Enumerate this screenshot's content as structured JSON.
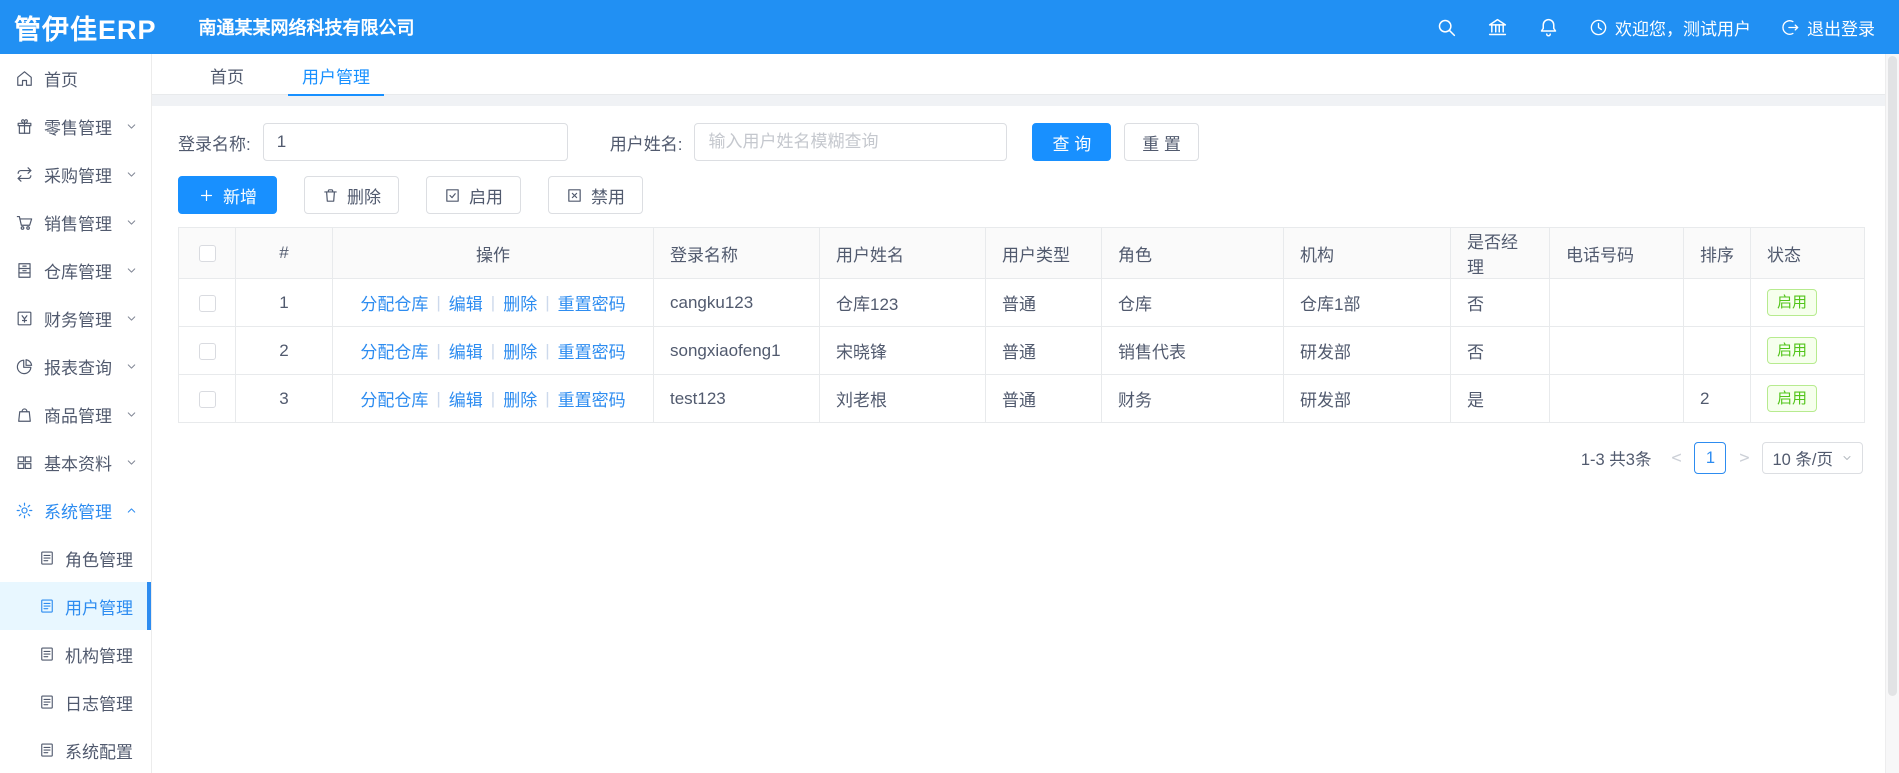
{
  "colors": {
    "header_bg": "#2190f3",
    "primary": "#1890ff",
    "link_blue": "#2d8cf0",
    "status_green": "#52c41a",
    "status_green_bg": "#f6ffed",
    "status_green_border": "#b7eb8f",
    "active_menu_bg": "#e8f7ff"
  },
  "header": {
    "logo": "管伊佳ERP",
    "company": "南通某某网络科技有限公司",
    "welcome": "欢迎您，测试用户",
    "logout": "退出登录"
  },
  "sidebar": {
    "items": [
      {
        "label": "首页",
        "icon": "home-icon"
      },
      {
        "label": "零售管理",
        "icon": "retail-icon"
      },
      {
        "label": "采购管理",
        "icon": "purchase-icon"
      },
      {
        "label": "销售管理",
        "icon": "sales-icon"
      },
      {
        "label": "仓库管理",
        "icon": "warehouse-icon"
      },
      {
        "label": "财务管理",
        "icon": "finance-icon"
      },
      {
        "label": "报表查询",
        "icon": "report-icon"
      },
      {
        "label": "商品管理",
        "icon": "goods-icon"
      },
      {
        "label": "基本资料",
        "icon": "basic-icon"
      },
      {
        "label": "系统管理",
        "icon": "system-icon"
      }
    ],
    "system_children": [
      {
        "label": "角色管理"
      },
      {
        "label": "用户管理",
        "active": true
      },
      {
        "label": "机构管理"
      },
      {
        "label": "日志管理"
      },
      {
        "label": "系统配置"
      }
    ]
  },
  "tabs": [
    {
      "label": "首页"
    },
    {
      "label": "用户管理",
      "active": true
    }
  ],
  "search": {
    "login_label": "登录名称:",
    "login_value": "1",
    "name_label": "用户姓名:",
    "name_placeholder": "输入用户姓名模糊查询",
    "query": "查 询",
    "reset": "重 置"
  },
  "toolbar": {
    "add": "新增",
    "delete": "删除",
    "enable": "启用",
    "disable": "禁用"
  },
  "table": {
    "columns": [
      "#",
      "操作",
      "登录名称",
      "用户姓名",
      "用户类型",
      "角色",
      "机构",
      "是否经理",
      "电话号码",
      "排序",
      "状态"
    ],
    "action_links": [
      "分配仓库",
      "编辑",
      "删除",
      "重置密码"
    ],
    "rows": [
      {
        "index": "1",
        "login": "cangku123",
        "name": "仓库123",
        "type": "普通",
        "role": "仓库",
        "org": "仓库1部",
        "manager": "否",
        "phone": "",
        "sort": "",
        "status": "启用"
      },
      {
        "index": "2",
        "login": "songxiaofeng1",
        "name": "宋晓锋",
        "type": "普通",
        "role": "销售代表",
        "org": "研发部",
        "manager": "否",
        "phone": "",
        "sort": "",
        "status": "启用"
      },
      {
        "index": "3",
        "login": "test123",
        "name": "刘老根",
        "type": "普通",
        "role": "财务",
        "org": "研发部",
        "manager": "是",
        "phone": "",
        "sort": "2",
        "status": "启用"
      }
    ]
  },
  "pagination": {
    "total": "1-3 共3条",
    "prev": "<",
    "page": "1",
    "next": ">",
    "page_size": "10 条/页"
  }
}
